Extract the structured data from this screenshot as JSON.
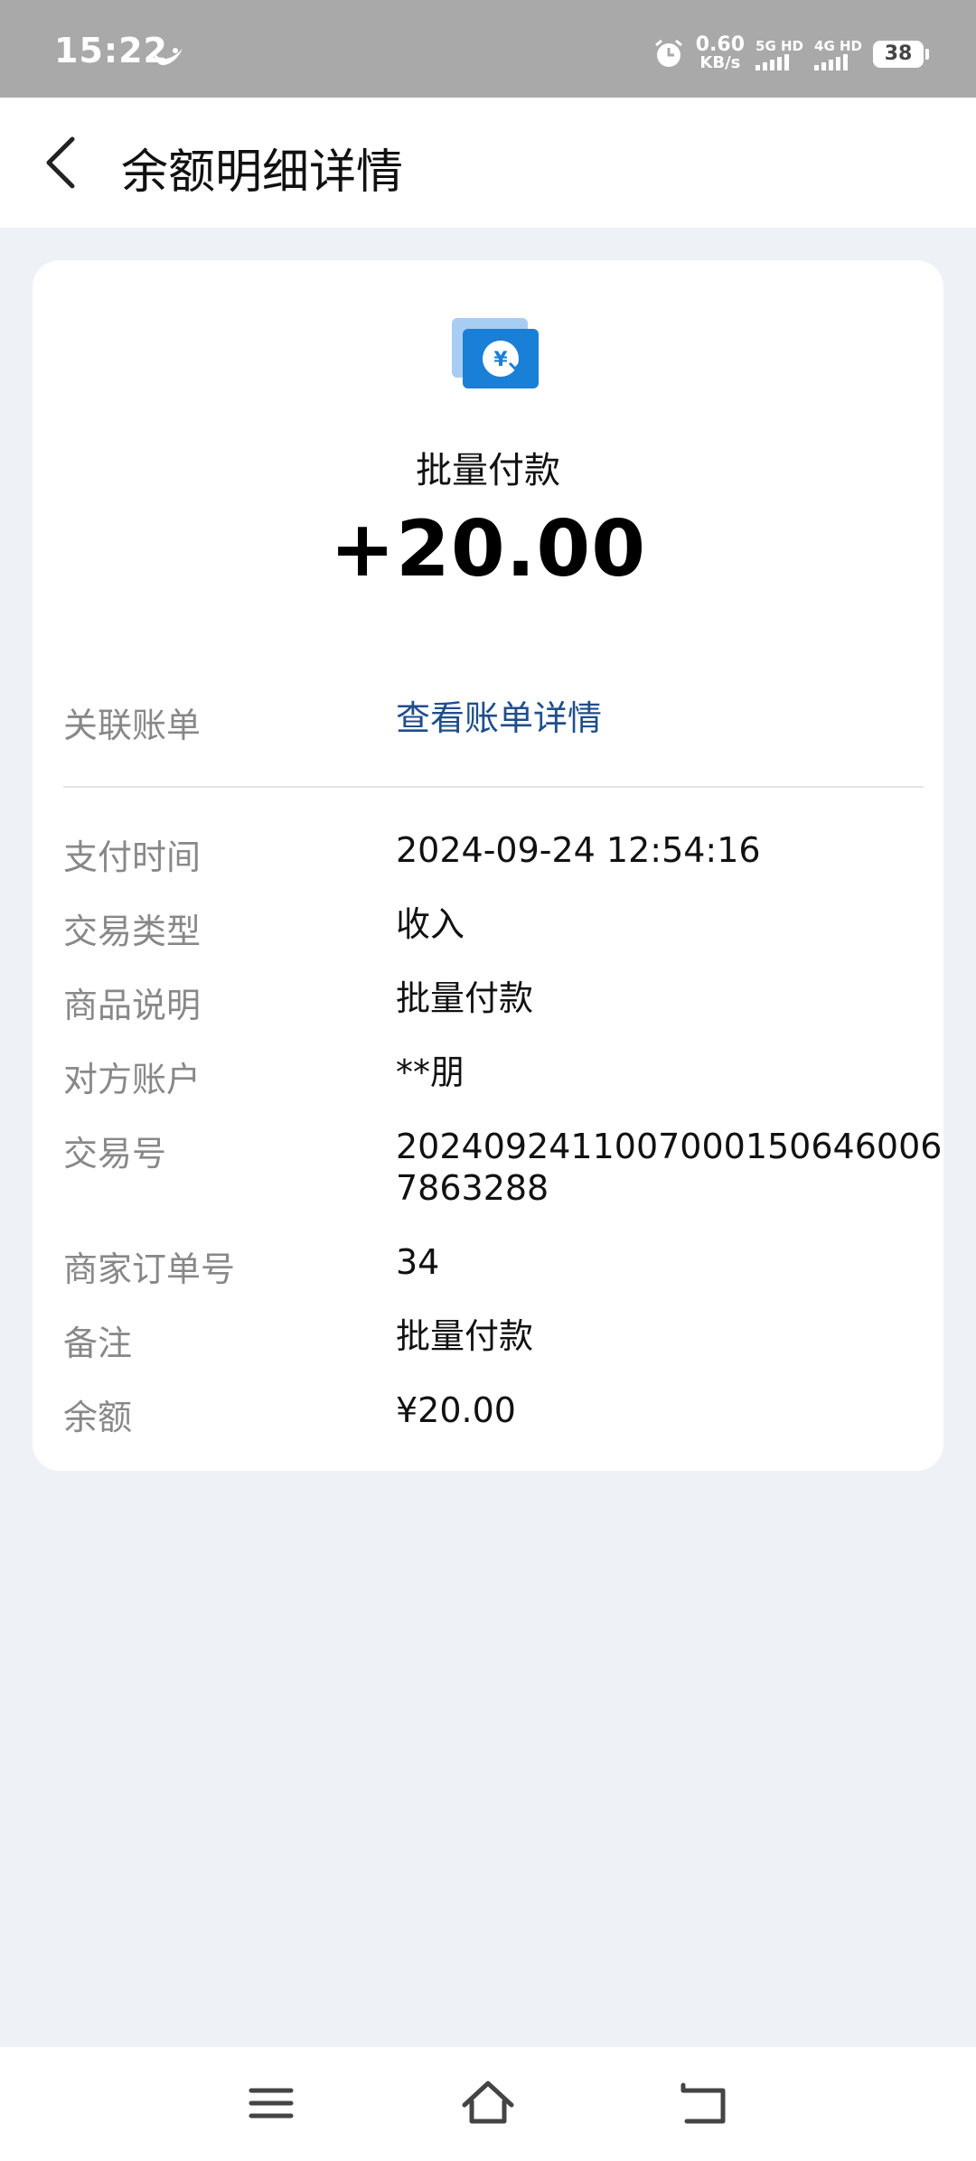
{
  "status_bar": {
    "time": "15:22",
    "net_speed_value": "0.60",
    "net_speed_unit": "KB/s",
    "signal1_label": "5G HD",
    "signal2_label": "4G HD",
    "battery": "38"
  },
  "header": {
    "title": "余额明细详情"
  },
  "summary": {
    "name": "批量付款",
    "amount": "+20.00"
  },
  "linked_bill": {
    "label": "关联账单",
    "value": "查看账单详情"
  },
  "details": [
    {
      "label": "支付时间",
      "value": "2024-09-24 12:54:16"
    },
    {
      "label": "交易类型",
      "value": "收入"
    },
    {
      "label": "商品说明",
      "value": "批量付款"
    },
    {
      "label": "对方账户",
      "value": "**朋"
    },
    {
      "label": "交易号",
      "value": "2024092411007000150646006 7863288"
    },
    {
      "label": "商家订单号",
      "value": "34"
    },
    {
      "label": "备注",
      "value": "批量付款"
    },
    {
      "label": "余额",
      "value": "¥20.00"
    }
  ],
  "colors": {
    "link": "#1f4e8c",
    "icon_blue": "#1a7fd6",
    "background": "#eef2f7"
  },
  "icons": {
    "back": "chevron-left-icon",
    "transaction": "balance-transfer-icon",
    "nav_menu": "menu-icon",
    "nav_home": "home-icon",
    "nav_back": "return-icon"
  }
}
